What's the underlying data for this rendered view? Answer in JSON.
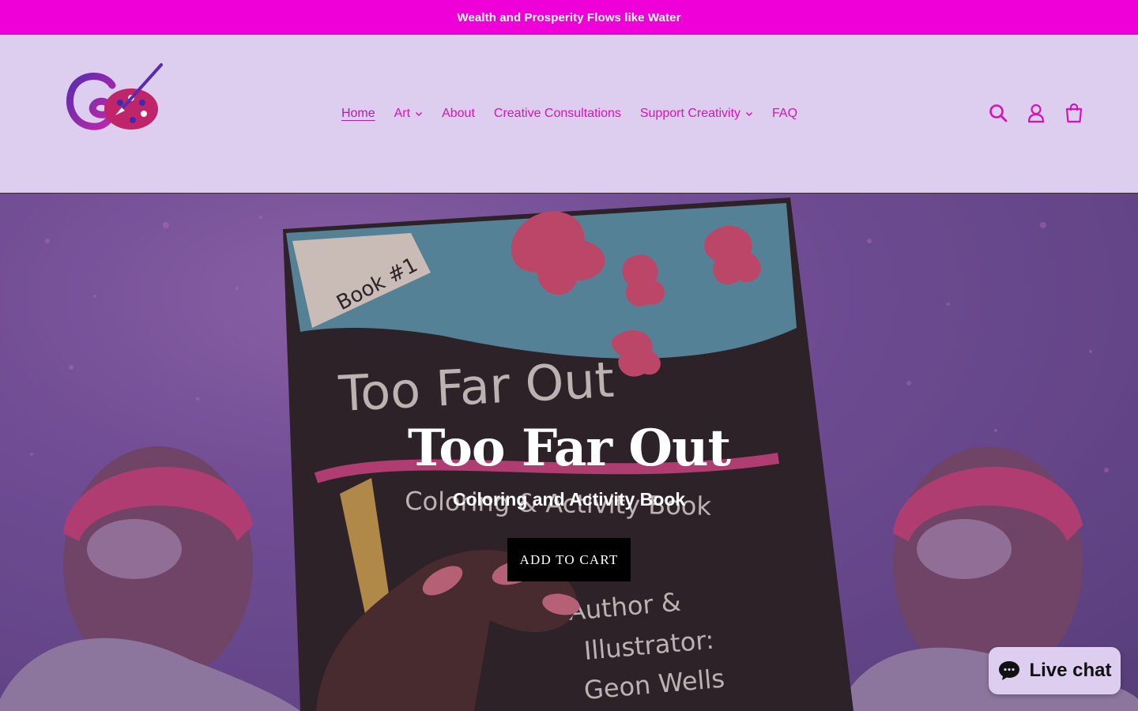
{
  "announcement": {
    "text": "Wealth and Prosperity Flows like Water"
  },
  "header": {
    "nav": [
      {
        "label": "Home",
        "active": true,
        "dropdown": false
      },
      {
        "label": "Art",
        "active": false,
        "dropdown": true
      },
      {
        "label": "About",
        "active": false,
        "dropdown": false
      },
      {
        "label": "Creative Consultations",
        "active": false,
        "dropdown": false
      },
      {
        "label": "Support Creativity",
        "active": false,
        "dropdown": true
      },
      {
        "label": "FAQ",
        "active": false,
        "dropdown": false
      }
    ],
    "icons": [
      "search-icon",
      "account-icon",
      "cart-icon"
    ]
  },
  "hero": {
    "title": "Too Far Out",
    "subtitle": "Coloring and Activity Book",
    "button_label": "ADD TO CART",
    "book_cover": {
      "badge": "Book #1",
      "title": "Too Far Out",
      "subtitle": "Coloring & Activity Book",
      "credit_line1": "Author &",
      "credit_line2": "Illustrator:",
      "credit_line3": "Geon Wells"
    }
  },
  "chat": {
    "label": "Live chat",
    "icon": "chat-bubble-icon"
  },
  "colors": {
    "announcement_bg": "#f000d8",
    "header_bg": "#ddcdee",
    "nav_link": "#d613b8",
    "button_bg": "#000000"
  }
}
